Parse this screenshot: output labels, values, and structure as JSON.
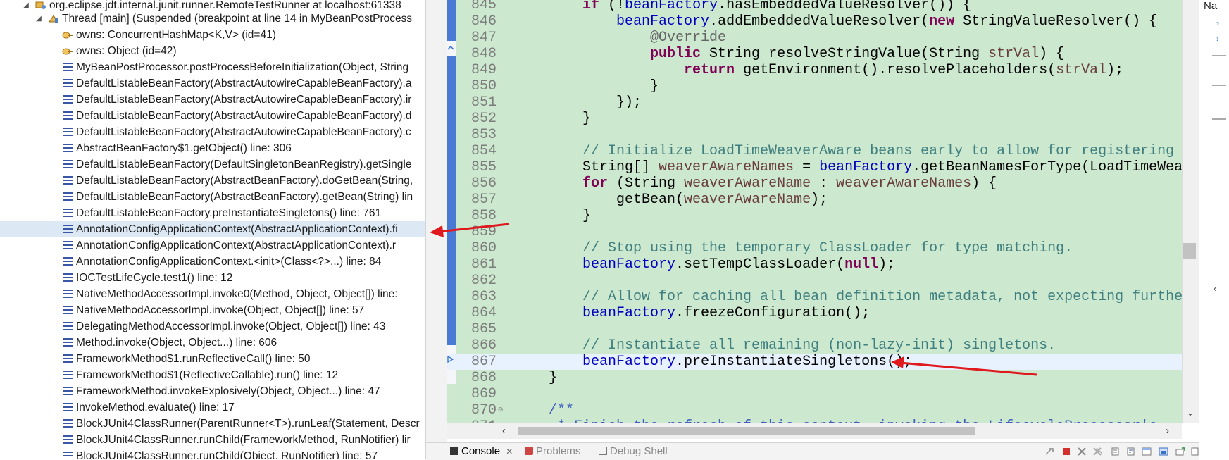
{
  "stack_tree": {
    "target": "org.eclipse.jdt.internal.junit.runner.RemoteTestRunner at localhost:61338",
    "thread": "Thread [main] (Suspended (breakpoint at line 14 in MyBeanPostProcess",
    "monitors": [
      "owns: ConcurrentHashMap<K,V>  (id=41)",
      "owns: Object  (id=42)"
    ],
    "frames": [
      "MyBeanPostProcessor.postProcessBeforeInitialization(Object, String",
      "DefaultListableBeanFactory(AbstractAutowireCapableBeanFactory).a",
      "DefaultListableBeanFactory(AbstractAutowireCapableBeanFactory).ir",
      "DefaultListableBeanFactory(AbstractAutowireCapableBeanFactory).d",
      "DefaultListableBeanFactory(AbstractAutowireCapableBeanFactory).c",
      "AbstractBeanFactory$1.getObject() line: 306",
      "DefaultListableBeanFactory(DefaultSingletonBeanRegistry).getSingle",
      "DefaultListableBeanFactory(AbstractBeanFactory).doGetBean(String,",
      "DefaultListableBeanFactory(AbstractBeanFactory).getBean(String) lin",
      "DefaultListableBeanFactory.preInstantiateSingletons() line: 761",
      "AnnotationConfigApplicationContext(AbstractApplicationContext).fi",
      "AnnotationConfigApplicationContext(AbstractApplicationContext).r",
      "AnnotationConfigApplicationContext.<init>(Class<?>...) line: 84",
      "IOCTestLifeCycle.test1() line: 12",
      "NativeMethodAccessorImpl.invoke0(Method, Object, Object[]) line:",
      "NativeMethodAccessorImpl.invoke(Object, Object[]) line: 57",
      "DelegatingMethodAccessorImpl.invoke(Object, Object[]) line: 43",
      "Method.invoke(Object, Object...) line: 606",
      "FrameworkMethod$1.runReflectiveCall() line: 50",
      "FrameworkMethod$1(ReflectiveCallable).run() line: 12",
      "FrameworkMethod.invokeExplosively(Object, Object...) line: 47",
      "InvokeMethod.evaluate() line: 17",
      "BlockJUnit4ClassRunner(ParentRunner<T>).runLeaf(Statement, Descr",
      "BlockJUnit4ClassRunner.runChild(FrameworkMethod, RunNotifier) lir",
      "BlockJUnit4ClassRunner.runChild(Object, RunNotifier) line: 57"
    ],
    "selected_frame_index": 10
  },
  "editor": {
    "current_line": "867",
    "lines": [
      {
        "n": "845",
        "fold": "",
        "t": [
          [
            "        ",
            ""
          ],
          [
            "if",
            "kw"
          ],
          [
            " (!",
            ""
          ],
          [
            "beanFactory",
            "fld"
          ],
          [
            ".hasEmbeddedValueResolver()) {",
            ""
          ]
        ]
      },
      {
        "n": "846",
        "fold": "",
        "t": [
          [
            "            ",
            ""
          ],
          [
            "beanFactory",
            "fld"
          ],
          [
            ".addEmbeddedValueResolver(",
            ""
          ],
          [
            "new",
            "kw"
          ],
          [
            " StringValueResolver() {",
            ""
          ]
        ]
      },
      {
        "n": "847",
        "fold": "",
        "t": [
          [
            "                ",
            ""
          ],
          [
            "@Override",
            "an"
          ]
        ]
      },
      {
        "n": "848",
        "fold": "",
        "t": [
          [
            "                ",
            ""
          ],
          [
            "public",
            "kw"
          ],
          [
            " String resolveStringValue(String ",
            ""
          ],
          [
            "strVal",
            "lv"
          ],
          [
            ") {",
            ""
          ]
        ]
      },
      {
        "n": "849",
        "fold": "",
        "t": [
          [
            "                    ",
            ""
          ],
          [
            "return",
            "kw"
          ],
          [
            " getEnvironment().resolvePlaceholders(",
            ""
          ],
          [
            "strVal",
            "lv"
          ],
          [
            ");",
            ""
          ]
        ]
      },
      {
        "n": "850",
        "fold": "",
        "t": [
          [
            "                }",
            ""
          ]
        ]
      },
      {
        "n": "851",
        "fold": "",
        "t": [
          [
            "            });",
            ""
          ]
        ]
      },
      {
        "n": "852",
        "fold": "",
        "t": [
          [
            "        }",
            ""
          ]
        ]
      },
      {
        "n": "853",
        "fold": "",
        "t": [
          [
            "",
            ""
          ]
        ]
      },
      {
        "n": "854",
        "fold": "",
        "t": [
          [
            "        ",
            ""
          ],
          [
            "// Initialize LoadTimeWeaverAware beans early to allow for registering th",
            "cm"
          ]
        ]
      },
      {
        "n": "855",
        "fold": "",
        "t": [
          [
            "        String[] ",
            ""
          ],
          [
            "weaverAwareNames",
            "lv"
          ],
          [
            " = ",
            ""
          ],
          [
            "beanFactory",
            "fld"
          ],
          [
            ".getBeanNamesForType(LoadTimeWeave",
            ""
          ]
        ]
      },
      {
        "n": "856",
        "fold": "",
        "t": [
          [
            "        ",
            ""
          ],
          [
            "for",
            "kw"
          ],
          [
            " (String ",
            ""
          ],
          [
            "weaverAwareName",
            "lv"
          ],
          [
            " : ",
            ""
          ],
          [
            "weaverAwareNames",
            "lv"
          ],
          [
            ") {",
            ""
          ]
        ]
      },
      {
        "n": "857",
        "fold": "",
        "t": [
          [
            "            getBean(",
            ""
          ],
          [
            "weaverAwareName",
            "lv"
          ],
          [
            ");",
            ""
          ]
        ]
      },
      {
        "n": "858",
        "fold": "",
        "t": [
          [
            "        }",
            ""
          ]
        ]
      },
      {
        "n": "859",
        "fold": "",
        "t": [
          [
            "",
            ""
          ]
        ]
      },
      {
        "n": "860",
        "fold": "",
        "t": [
          [
            "        ",
            ""
          ],
          [
            "// Stop using the temporary ClassLoader for type matching.",
            "cm"
          ]
        ]
      },
      {
        "n": "861",
        "fold": "",
        "t": [
          [
            "        ",
            ""
          ],
          [
            "beanFactory",
            "fld"
          ],
          [
            ".setTempClassLoader(",
            ""
          ],
          [
            "null",
            "kw"
          ],
          [
            ");",
            ""
          ]
        ]
      },
      {
        "n": "862",
        "fold": "",
        "t": [
          [
            "",
            ""
          ]
        ]
      },
      {
        "n": "863",
        "fold": "",
        "t": [
          [
            "        ",
            ""
          ],
          [
            "// Allow for caching all bean definition metadata, not expecting further",
            "cm"
          ]
        ]
      },
      {
        "n": "864",
        "fold": "",
        "t": [
          [
            "        ",
            ""
          ],
          [
            "beanFactory",
            "fld"
          ],
          [
            ".freezeConfiguration();",
            ""
          ]
        ]
      },
      {
        "n": "865",
        "fold": "",
        "t": [
          [
            "",
            ""
          ]
        ]
      },
      {
        "n": "866",
        "fold": "",
        "t": [
          [
            "        ",
            ""
          ],
          [
            "// Instantiate all remaining (non-lazy-init) singletons.",
            "cm"
          ]
        ]
      },
      {
        "n": "867",
        "fold": "",
        "t": [
          [
            "        ",
            ""
          ],
          [
            "beanFactory",
            "fld"
          ],
          [
            ".preInstantiateSingletons();",
            ""
          ]
        ]
      },
      {
        "n": "868",
        "fold": "",
        "t": [
          [
            "    }",
            ""
          ]
        ]
      },
      {
        "n": "869",
        "fold": "",
        "t": [
          [
            "",
            ""
          ]
        ]
      },
      {
        "n": "870",
        "fold": "⊖",
        "t": [
          [
            "    ",
            ""
          ],
          [
            "/**",
            "jd"
          ]
        ]
      },
      {
        "n": "871",
        "fold": "",
        "t": [
          [
            "     ",
            ""
          ],
          [
            "* Finish the refresh of this context, invoking the LifecycleProcessor's",
            "jd"
          ]
        ]
      }
    ]
  },
  "bottom_tabs": {
    "console": "Console",
    "console_close": "✕",
    "problems": "Problems",
    "debug_shell": "Debug Shell"
  },
  "outline": {
    "header": "Na"
  },
  "colors": {
    "editor_bg": "#cce8cf",
    "current_line": "#e8f2fe",
    "selection": "#dde8f5",
    "arrow": "#e0191f"
  }
}
